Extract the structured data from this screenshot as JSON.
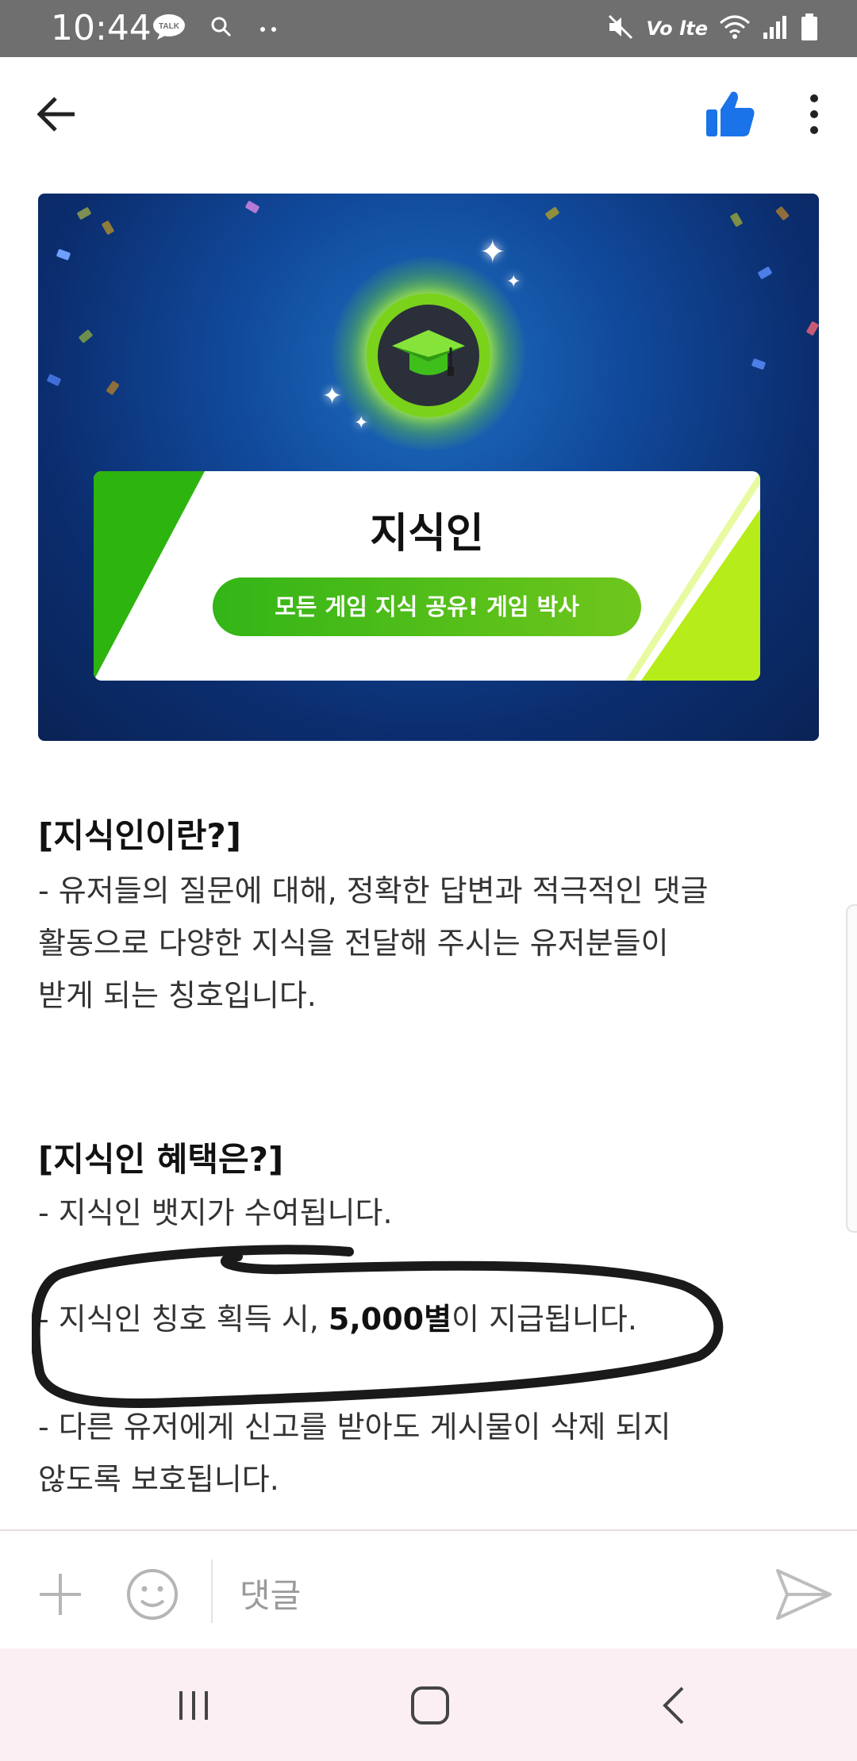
{
  "status_bar": {
    "time": "10:44",
    "notification_icons": [
      "kakaotalk-icon",
      "search-icon",
      "more-dots-icon"
    ],
    "right_icons": [
      "mute-icon",
      "volte-icon",
      "wifi-icon",
      "signal-icon",
      "battery-icon"
    ],
    "volte_label": "Vo lte"
  },
  "app_bar": {
    "back_icon": "arrow-left-icon",
    "like_icon": "thumbs-up-icon",
    "more_icon": "more-vertical-icon",
    "like_color": "#1a73e8"
  },
  "banner": {
    "title": "지식인",
    "subtitle": "모든 게임 지식 공유! 게임 박사",
    "badge_icon": "graduation-cap-icon",
    "colors": {
      "bg": "#0b2d6e",
      "green": "#2eb40f",
      "lime": "#b6ec1a"
    }
  },
  "sections": [
    {
      "title": "[지식인이란?]",
      "lines": [
        "- 유저들의 질문에 대해, 정확한 답변과 적극적인 댓글",
        "활동으로 다양한 지식을 전달해 주시는 유저분들이",
        "받게 되는 칭호입니다."
      ]
    },
    {
      "title": "[지식인 혜택은?]",
      "lines": [
        "- 지식인 뱃지가 수여됩니다.",
        "- 다른 유저에게 신고를 받아도 게시물이 삭제 되지",
        "않도록 보호됩니다."
      ],
      "highlight": {
        "before": "- 지식인 칭호 획득 시, ",
        "bold": "5,000별",
        "after": "이 지급됩니다."
      }
    }
  ],
  "comment_bar": {
    "placeholder": "댓글",
    "icons": [
      "plus-icon",
      "emoji-icon",
      "send-icon"
    ]
  },
  "nav_bar": {
    "icons": [
      "recent-apps-icon",
      "home-icon",
      "back-icon"
    ]
  }
}
